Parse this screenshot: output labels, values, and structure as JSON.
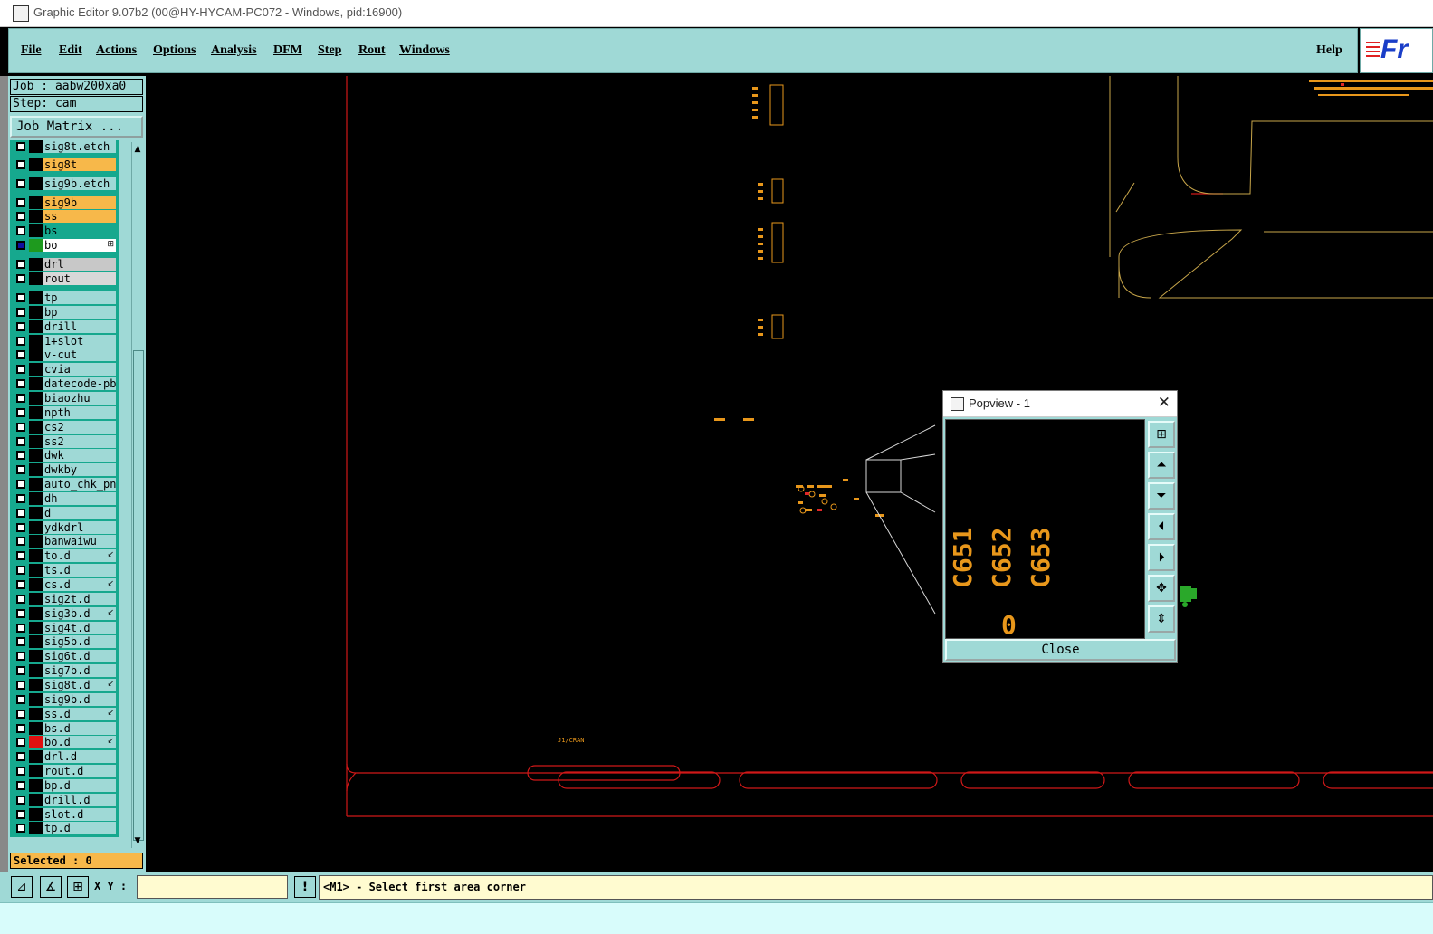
{
  "window": {
    "title": "Graphic Editor 9.07b2 (00@HY-HYCAM-PC072 - Windows, pid:16900)"
  },
  "menubar": {
    "items": [
      "File",
      "Edit",
      "Actions",
      "Options",
      "Analysis",
      "DFM",
      "Step",
      "Rout",
      "Windows"
    ],
    "help": "Help",
    "logo_text": "Fr"
  },
  "left_panel": {
    "job": "Job : aabw200xa0",
    "step": "Step: cam",
    "job_matrix": "Job Matrix ...",
    "selected": "Selected : 0"
  },
  "layers": [
    {
      "name": "sig8t.etch",
      "bg": "#9fd9d6",
      "swatch": "#000000"
    },
    {
      "name": "sig8t",
      "bg": "#f7b84a",
      "swatch": "#000000"
    },
    {
      "name": "sig9b.etch",
      "bg": "#9fd9d6",
      "swatch": "#000000"
    },
    {
      "name": "sig9b",
      "bg": "#f7b84a",
      "swatch": "#000000"
    },
    {
      "name": "ss",
      "bg": "#f7b84a",
      "swatch": "#000000"
    },
    {
      "name": "bs",
      "bg": "#16a88e",
      "swatch": "#000000"
    },
    {
      "name": "bo",
      "bg": "#ffffff",
      "swatch": "#1e9a1e",
      "mark": "⊞"
    },
    {
      "name": "drl",
      "bg": "#c8c8c8",
      "swatch": "#000000"
    },
    {
      "name": "rout",
      "bg": "#d8d8d8",
      "swatch": "#000000"
    },
    {
      "name": "tp",
      "bg": "#9fd9d6",
      "swatch": "#000000"
    },
    {
      "name": "bp",
      "bg": "#9fd9d6",
      "swatch": "#000000"
    },
    {
      "name": "drill",
      "bg": "#9fd9d6",
      "swatch": "#000000"
    },
    {
      "name": "1+slot",
      "bg": "#9fd9d6",
      "swatch": "#000000"
    },
    {
      "name": "v-cut",
      "bg": "#9fd9d6",
      "swatch": "#000000"
    },
    {
      "name": "cvia",
      "bg": "#9fd9d6",
      "swatch": "#000000"
    },
    {
      "name": "datecode-pbc",
      "bg": "#9fd9d6",
      "swatch": "#000000"
    },
    {
      "name": "biaozhu",
      "bg": "#9fd9d6",
      "swatch": "#000000"
    },
    {
      "name": "npth",
      "bg": "#9fd9d6",
      "swatch": "#000000"
    },
    {
      "name": "cs2",
      "bg": "#9fd9d6",
      "swatch": "#000000"
    },
    {
      "name": "ss2",
      "bg": "#9fd9d6",
      "swatch": "#000000"
    },
    {
      "name": "dwk",
      "bg": "#9fd9d6",
      "swatch": "#000000"
    },
    {
      "name": "dwkby",
      "bg": "#9fd9d6",
      "swatch": "#000000"
    },
    {
      "name": "auto_chk_pnl",
      "bg": "#9fd9d6",
      "swatch": "#000000"
    },
    {
      "name": "dh",
      "bg": "#9fd9d6",
      "swatch": "#000000"
    },
    {
      "name": "d",
      "bg": "#9fd9d6",
      "swatch": "#000000"
    },
    {
      "name": "ydkdrl",
      "bg": "#9fd9d6",
      "swatch": "#000000"
    },
    {
      "name": "banwaiwu",
      "bg": "#9fd9d6",
      "swatch": "#000000"
    },
    {
      "name": "to.d",
      "bg": "#9fd9d6",
      "swatch": "#000000",
      "mark": "↙"
    },
    {
      "name": "ts.d",
      "bg": "#9fd9d6",
      "swatch": "#000000"
    },
    {
      "name": "cs.d",
      "bg": "#9fd9d6",
      "swatch": "#000000",
      "mark": "↙"
    },
    {
      "name": "sig2t.d",
      "bg": "#9fd9d6",
      "swatch": "#000000"
    },
    {
      "name": "sig3b.d",
      "bg": "#9fd9d6",
      "swatch": "#000000",
      "mark": "↙"
    },
    {
      "name": "sig4t.d",
      "bg": "#9fd9d6",
      "swatch": "#000000"
    },
    {
      "name": "sig5b.d",
      "bg": "#9fd9d6",
      "swatch": "#000000"
    },
    {
      "name": "sig6t.d",
      "bg": "#9fd9d6",
      "swatch": "#000000"
    },
    {
      "name": "sig7b.d",
      "bg": "#9fd9d6",
      "swatch": "#000000"
    },
    {
      "name": "sig8t.d",
      "bg": "#9fd9d6",
      "swatch": "#000000",
      "mark": "↙"
    },
    {
      "name": "sig9b.d",
      "bg": "#9fd9d6",
      "swatch": "#000000"
    },
    {
      "name": "ss.d",
      "bg": "#9fd9d6",
      "swatch": "#000000",
      "mark": "↙"
    },
    {
      "name": "bs.d",
      "bg": "#9fd9d6",
      "swatch": "#000000"
    },
    {
      "name": "bo.d",
      "bg": "#9fd9d6",
      "swatch": "#e01010",
      "mark": "↙"
    },
    {
      "name": "drl.d",
      "bg": "#9fd9d6",
      "swatch": "#000000"
    },
    {
      "name": "rout.d",
      "bg": "#9fd9d6",
      "swatch": "#000000"
    },
    {
      "name": "bp.d",
      "bg": "#9fd9d6",
      "swatch": "#000000"
    },
    {
      "name": "drill.d",
      "bg": "#9fd9d6",
      "swatch": "#000000"
    },
    {
      "name": "slot.d",
      "bg": "#9fd9d6",
      "swatch": "#000000"
    },
    {
      "name": "tp.d",
      "bg": "#9fd9d6",
      "swatch": "#000000"
    }
  ],
  "canvas": {
    "label_bottom": "J1/CRAN"
  },
  "popview": {
    "title": "Popview - 1",
    "close_label": "Close",
    "pcb_labels": [
      "C651",
      "C652",
      "C653"
    ],
    "pad_label": "0",
    "buttons": [
      "zoom-fit-icon",
      "pan-up-icon",
      "pan-down-icon",
      "pan-left-icon",
      "pan-right-icon",
      "zoom-in-icon",
      "zoom-out-icon"
    ]
  },
  "bottom": {
    "xy_label": "X Y :",
    "xy_value": "",
    "info_button": "!",
    "message": "<M1> - Select first area corner"
  },
  "colors": {
    "panel": "#9fd9d6",
    "accent_orange": "#f7b84a",
    "accent_green": "#16a88e",
    "board_outline": "#d01818",
    "silk": "#e8971b"
  }
}
